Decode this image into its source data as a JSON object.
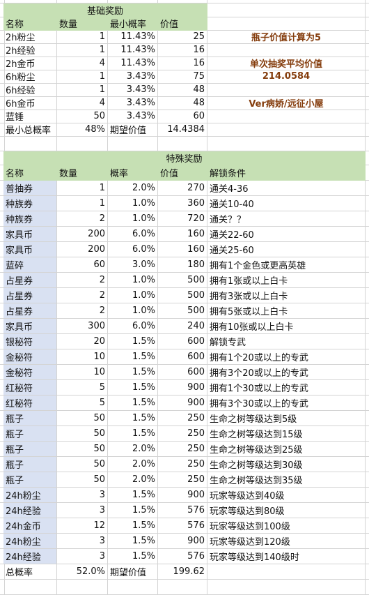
{
  "basic": {
    "title": "基础奖励",
    "headers": [
      "名称",
      "数量",
      "最小概率",
      "价值"
    ],
    "rows": [
      [
        "2h粉尘",
        "1",
        "11.43%",
        "25"
      ],
      [
        "2h经验",
        "1",
        "11.43%",
        "16"
      ],
      [
        "2h金币",
        "4",
        "11.43%",
        "16"
      ],
      [
        "6h粉尘",
        "1",
        "3.43%",
        "75"
      ],
      [
        "6h经验",
        "1",
        "3.43%",
        "48"
      ],
      [
        "6h金币",
        "4",
        "3.43%",
        "48"
      ],
      [
        "蓝锤",
        "50",
        "3.43%",
        "60"
      ]
    ],
    "summary": [
      "最小总概率",
      "48%",
      "期望价值",
      "14.4384"
    ]
  },
  "notes": {
    "bottle_value": "瓶子价值计算为5",
    "avg_label": "单次抽奖平均价值",
    "avg_value": "214.0584",
    "author": "Ver病娇/远征小屋",
    "color": "#843c0c"
  },
  "special": {
    "title": "特殊奖励",
    "headers": [
      "名称",
      "数量",
      "概率",
      "价值",
      "解锁条件"
    ],
    "rows": [
      [
        "普抽券",
        "1",
        "2.0%",
        "270",
        "通关4-36"
      ],
      [
        "种族券",
        "1",
        "1.0%",
        "360",
        "通关10-40"
      ],
      [
        "种族券",
        "2",
        "1.0%",
        "720",
        "通关？？"
      ],
      [
        "家具币",
        "200",
        "6.0%",
        "160",
        "通关22-60"
      ],
      [
        "家具币",
        "200",
        "6.0%",
        "160",
        "通关25-60"
      ],
      [
        "蓝碎",
        "60",
        "3.0%",
        "180",
        "拥有1个金色或更高英雄"
      ],
      [
        "占星券",
        "2",
        "1.0%",
        "500",
        "拥有1张或以上白卡"
      ],
      [
        "占星券",
        "2",
        "1.0%",
        "500",
        "拥有3张或以上白卡"
      ],
      [
        "占星券",
        "2",
        "1.0%",
        "500",
        "拥有5张或以上白卡"
      ],
      [
        "家具币",
        "300",
        "6.0%",
        "240",
        "拥有10张或以上白卡"
      ],
      [
        "银秘符",
        "20",
        "1.5%",
        "600",
        "解锁专武"
      ],
      [
        "金秘符",
        "10",
        "1.5%",
        "600",
        "拥有1个20或以上的专武"
      ],
      [
        "金秘符",
        "10",
        "1.5%",
        "600",
        "拥有3个20或以上的专武"
      ],
      [
        "红秘符",
        "5",
        "1.5%",
        "900",
        "拥有1个30或以上的专武"
      ],
      [
        "红秘符",
        "5",
        "1.5%",
        "900",
        "拥有3个30或以上的专武"
      ],
      [
        "瓶子",
        "50",
        "1.5%",
        "250",
        "生命之树等级达到5级"
      ],
      [
        "瓶子",
        "50",
        "1.5%",
        "250",
        "生命之树等级达到15级"
      ],
      [
        "瓶子",
        "50",
        "2.0%",
        "250",
        "生命之树等级达到25级"
      ],
      [
        "瓶子",
        "50",
        "2.0%",
        "250",
        "生命之树等级达到30级"
      ],
      [
        "瓶子",
        "50",
        "2.0%",
        "250",
        "生命之树等级达到35级"
      ],
      [
        "24h粉尘",
        "3",
        "1.5%",
        "900",
        "玩家等级达到40级"
      ],
      [
        "24h经验",
        "3",
        "1.5%",
        "576",
        "玩家等级达到80级"
      ],
      [
        "24h金币",
        "12",
        "1.5%",
        "576",
        "玩家等级达到100级"
      ],
      [
        "24h粉尘",
        "3",
        "1.5%",
        "900",
        "玩家等级达到120级"
      ],
      [
        "24h经验",
        "3",
        "1.5%",
        "576",
        "玩家等级达到140级时"
      ]
    ],
    "summary": [
      "总概率",
      "52.0%",
      "期望价值",
      "199.62"
    ]
  },
  "colors": {
    "header_green": "#c6e0b4",
    "name_blue": "#d9e1f2",
    "grid": "#d4d4d4"
  }
}
